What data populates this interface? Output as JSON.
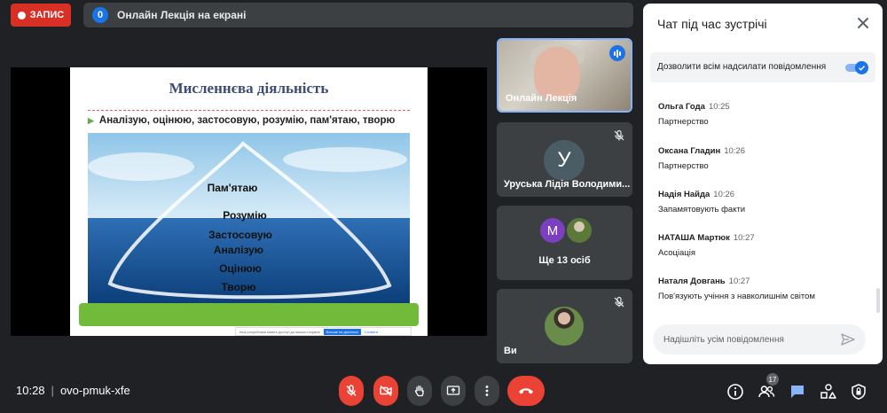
{
  "top_bar": {
    "record_label": "ЗАПИС",
    "presentation_count": "0",
    "presentation_text": "Онлайн Лекція на екрані"
  },
  "slide": {
    "title": "Мисленнєва діяльність",
    "bullet": "Аналізую, оцінюю, застосовую, розумію, пам'ятаю, творю",
    "pyramid_words": [
      "Пам'ятаю",
      "Розумію",
      "Застосовую",
      "Аналізую",
      "Оцінюю",
      "Творю"
    ],
    "notice_text": "Інші розробники мають доступ до вашого екрана",
    "notice_stop": "Більше не ділитися",
    "notice_hide": "Сховати"
  },
  "participants": [
    {
      "name": "Онлайн Лекція",
      "state": "speaking"
    },
    {
      "name": "Уруська Лідія Володими...",
      "avatar_letter": "У",
      "state": "muted"
    },
    {
      "name": "Ще 13 осіб",
      "avatar_letter": "М"
    },
    {
      "name": "Ви",
      "state": "muted"
    }
  ],
  "chat": {
    "title": "Чат під час зустрічі",
    "setting_label": "Дозволити всім надсилати повідомлення",
    "setting_on": true,
    "messages": [
      {
        "sender": "Ольга Года",
        "time": "10:25",
        "text": "Партнерство"
      },
      {
        "sender": "Оксана Гладин",
        "time": "10:26",
        "text": "Партнерство"
      },
      {
        "sender": "Надія Найда",
        "time": "10:26",
        "text": "Запамятовують факти"
      },
      {
        "sender": "НАТАША Мартюк",
        "time": "10:27",
        "text": "Асоціація"
      },
      {
        "sender": "Наталя Довгань",
        "time": "10:27",
        "text": "Пов'язують учіння з навколишнім світом"
      }
    ],
    "input_placeholder": "Надішліть усім повідомлення"
  },
  "bottom_bar": {
    "time": "10:28",
    "meeting_code": "ovo-pmuk-xfe",
    "people_count": "17"
  },
  "colors": {
    "background": "#202124",
    "danger": "#ea4335",
    "accent": "#1a73e8",
    "chat_active": "#8ab4f8"
  },
  "icons": [
    "record-dot-icon",
    "mic-off-icon",
    "camera-off-icon",
    "raise-hand-icon",
    "present-screen-icon",
    "more-options-icon",
    "end-call-icon",
    "info-icon",
    "people-icon",
    "chat-icon",
    "activities-icon",
    "host-controls-icon",
    "close-icon",
    "send-icon",
    "speaking-icon"
  ]
}
